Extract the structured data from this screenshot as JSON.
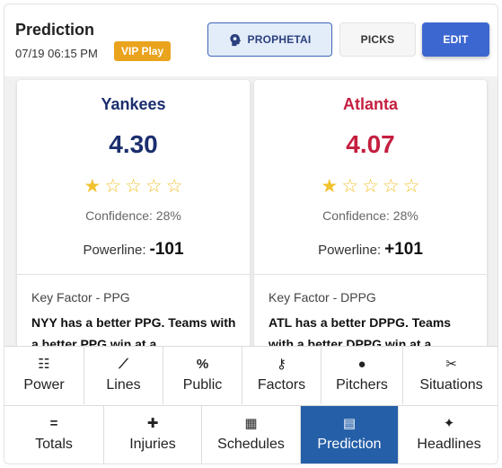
{
  "header": {
    "title": "Prediction",
    "datetime": "07/19 06:15 PM",
    "badge": "VIP Play",
    "buttons": {
      "prophet": "PROPHETAI",
      "picks": "PICKS",
      "edit": "EDIT"
    }
  },
  "teams": [
    {
      "name": "Yankees",
      "score": "4.30",
      "stars": [
        "★",
        "☆",
        "☆",
        "☆",
        "☆"
      ],
      "rating_stars": 1,
      "confidence": "Confidence: 28%",
      "powerline_label": "Powerline:",
      "powerline_value": "-101",
      "key_factor_title": "Key Factor - PPG",
      "key_factor_text": "NYY has a better PPG. Teams with a better PPG win at a"
    },
    {
      "name": "Atlanta",
      "score": "4.07",
      "stars": [
        "★",
        "☆",
        "☆",
        "☆",
        "☆"
      ],
      "rating_stars": 1,
      "confidence": "Confidence: 28%",
      "powerline_label": "Powerline:",
      "powerline_value": "+101",
      "key_factor_title": "Key Factor - DPPG",
      "key_factor_text": "ATL has a better DPPG. Teams with a better DPPG win at a"
    }
  ],
  "nav_row1": [
    {
      "label": "Power",
      "icon": "list-numbered-icon",
      "glyph": "☷"
    },
    {
      "label": "Lines",
      "icon": "chart-line-icon",
      "glyph": "⟋"
    },
    {
      "label": "Public",
      "icon": "percent-icon",
      "glyph": "%"
    },
    {
      "label": "Factors",
      "icon": "key-icon",
      "glyph": "⚷"
    },
    {
      "label": "Pitchers",
      "icon": "baseball-icon",
      "glyph": "●"
    },
    {
      "label": "Situations",
      "icon": "tools-icon",
      "glyph": "✂"
    }
  ],
  "nav_row2": [
    {
      "label": "Totals",
      "icon": "equals-icon",
      "glyph": "="
    },
    {
      "label": "Injuries",
      "icon": "medical-file-icon",
      "glyph": "✚"
    },
    {
      "label": "Schedules",
      "icon": "calendar-icon",
      "glyph": "▦"
    },
    {
      "label": "Prediction",
      "icon": "calculator-icon",
      "glyph": "▤"
    },
    {
      "label": "Headlines",
      "icon": "reader-icon",
      "glyph": "✦"
    }
  ],
  "colors": {
    "accent": "#3d67d0",
    "active_tab": "#255fa8",
    "vip": "#eaa31d",
    "home_team": "#1b2e6e",
    "away_team": "#c51f3f",
    "star": "#f2c230"
  }
}
